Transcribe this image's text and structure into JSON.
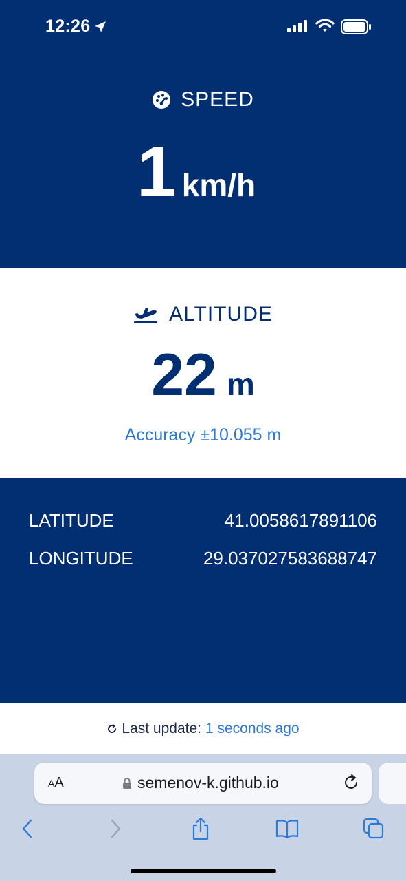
{
  "status_bar": {
    "time": "12:26",
    "icons": [
      "location-arrow-icon",
      "cellular-signal-icon",
      "wifi-icon",
      "battery-icon"
    ]
  },
  "speed": {
    "label": "SPEED",
    "icon": "speedometer-icon",
    "value": "1",
    "unit": "km/h"
  },
  "altitude": {
    "label": "ALTITUDE",
    "icon": "plane-takeoff-icon",
    "value": "22",
    "unit": "m",
    "accuracy": "Accuracy ±10.055 m"
  },
  "coordinates": {
    "latitude_label": "LATITUDE",
    "latitude_value": "41.0058617891106",
    "longitude_label": "LONGITUDE",
    "longitude_value": "29.037027583688747"
  },
  "update": {
    "label": "Last update:",
    "value": "1 seconds ago"
  },
  "browser": {
    "text_size_label": "AA",
    "url": "semenov-k.github.io",
    "toolbar": [
      "back-icon",
      "forward-icon",
      "share-icon",
      "bookmarks-icon",
      "tabs-icon"
    ]
  },
  "colors": {
    "panel_blue": "#012f72",
    "accent_blue": "#2e7bd6",
    "chrome_bg": "#c9d3e6"
  }
}
